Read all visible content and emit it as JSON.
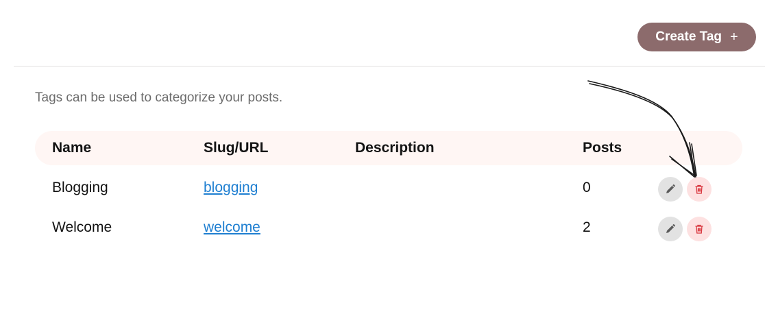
{
  "toolbar": {
    "create_label": "Create Tag",
    "create_icon": "+"
  },
  "intro_text": "Tags can be used to categorize your posts.",
  "table": {
    "columns": [
      "Name",
      "Slug/URL",
      "Description",
      "Posts"
    ],
    "rows": [
      {
        "name": "Blogging",
        "slug": "blogging",
        "description": "",
        "posts": "0"
      },
      {
        "name": "Welcome",
        "slug": "welcome",
        "description": "",
        "posts": "2"
      }
    ]
  },
  "colors": {
    "button": "#8c6b6c",
    "link": "#1f7fd1",
    "header_bg": "#fff6f4",
    "delete_bg": "#fde1e1",
    "delete_icon": "#d9363e",
    "edit_bg": "#e2e2e2"
  }
}
